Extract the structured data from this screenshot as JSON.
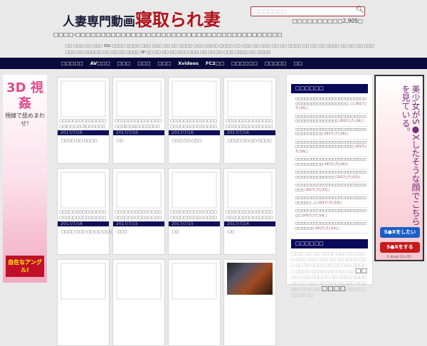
{
  "header": {
    "logo_a": "人妻専門動画",
    "logo_b": "寝取られ妻",
    "search_placeholder": "□□□□□□□",
    "count": "□□□□□□□□□□2,905□",
    "tagline": "□□□□-□□□□□□□□□□□□□□□□□□□□□□□□□□□□□□□□□□□□□□□□□",
    "keywords": "□□ □□□ □□ □□□ 3SX □□□□ □□□□ □□□ □□□ □□ □□ □□□□ □□□ □□□□ □□□□ □□ □□□ □□ □□□ □□ □□ □□□□ □□ □□ □□ □□□□ □□ □□ □□ □□□ □□□ □□ □□□□□ □□ □□ □□ □□□□ 3P □□ □□ □□ □□ □□□ □□□ □□ □□ □□ □□□ □□□□ □□ □□□□"
  },
  "nav": [
    "□□□□□",
    "AV□□□",
    "□□□",
    "□□□",
    "□□□",
    "Xvideos",
    "FC2□□",
    "□□□□□□",
    "□□□□□",
    "□□"
  ],
  "ads": {
    "left": {
      "title": "3D 視姦",
      "sub": "視線で舐めまわせ!",
      "footer": "自在なアングル!"
    },
    "right": {
      "copy": "美少女がS●Xしたそうな顔でこちらを見ている。",
      "btn1": "S●Xをしたい",
      "btn2": "S●Xをする",
      "credit": "© Kaisel CO.,LTD."
    }
  },
  "posts": [
    {
      "title": "□□□□□□□□□□□□□□□□(□□□□□)□□□□□□□□□□",
      "date": "2017/7/16",
      "tags": "□□□□·□□·□□□□"
    },
    {
      "title": "□□□□□□□□□□□□□□□□□(□□□□□□□□□□□□□□",
      "date": "2017/7/16",
      "tags": "□□"
    },
    {
      "title": "□□□□□□□□□□□□□□□□□□□□□□□□□□□□□□□□",
      "date": "2017/7/16",
      "tags": "□□□·□□·□□□"
    },
    {
      "title": "□□□□□□□□□□□□□□□□□□□□□□□□□□□□□□□□",
      "date": "2017/7/16",
      "tags": "□□□□·□□·□□·□□□□"
    },
    {
      "title": "□□□□□□□□□□□□□□□□□□□□□□□□□□□□□□□□",
      "date": "2017/7/16",
      "tags": "□□□□·□□□·□□·□□·□□·□□□□"
    },
    {
      "title": "□□□□□□□□□□□□□□□□□□□□□□□□□□□□□□□□",
      "date": "2017/7/15",
      "tags": "□□□"
    },
    {
      "title": "□□□□□□□□□□□□□□□□□□□□□□□□□□□□□□□□",
      "date": "2017/7/15",
      "tags": "□□"
    },
    {
      "title": "□□□□□□□□□□□□□□□□□□□□□□□□□□□□□□□□",
      "date": "2017/7/14",
      "tags": "□□"
    }
  ],
  "sidebar": {
    "recent_title": "□□□□□□",
    "recent": [
      {
        "t": "□□□□□□□□□□□□□□□□□□□□□□□□□□□□□□□□□□□□□□□□…□",
        "d": "2017□7□16□"
      },
      {
        "t": "□□□□□□□□□□□□□□□□□□□□□□□□□□□□□□□□□□□□□",
        "d": "2017□7□16□"
      },
      {
        "t": "□□□□□□□□□□□□□□□□□□□□□□□□□□□□□□□□",
        "d": "2017□7□16□"
      },
      {
        "t": "□□□□□□□□□□□□□□□□□□□□□□□□□□□□□□□□□□□□□□□□□□",
        "d": "2017□7□16□"
      },
      {
        "t": "□□□□□□□□□□□□□□□□□□□□□□□□□□□□□□□□",
        "d": "2017□7□16□"
      },
      {
        "t": "□□□□□□□□□□□□□□□□□□□□□□□□□□□□□□□□□□□□",
        "d": "2017□7□15□"
      },
      {
        "t": "□□□□□□□□□□□□□□□□□□□□□□□□□□",
        "d": "2017□7□15□"
      },
      {
        "t": "□□□□□□□□□□□□□□□□□□□□□□□□□□□□…□",
        "d": "2017□7□14□"
      },
      {
        "t": "□□□□□□□□□□□□□□□□□□□□□□□□□",
        "d": "2017□7□14□"
      },
      {
        "t": "□□□□□□□□□□□□□□□□□□□□□□□□□□□□□",
        "d": "2017□7□14□"
      }
    ],
    "tags_title": "□□□□□□",
    "tags_a": "□□□□ □□ □□ □□□□ □□□ □□ □□□□ □□□ □□□ □□□ □□ □□ □□□□ □□□ □□ □□ □□□□ □□ □□ □□□ □□□□□ □□□□ □□ □□□□□ □□□ □□",
    "tag_big1": "□□",
    "tags_b": " □□ □ □□ □□□ □□ □□ □□□□ □□□□ □□ □□ □□□ □□ □□□ □□ □□□ □□□ □□□ □□□ □□",
    "tag_big2": "□□□□",
    "tags_c": " □□ □□ □□□ □□ □□"
  }
}
